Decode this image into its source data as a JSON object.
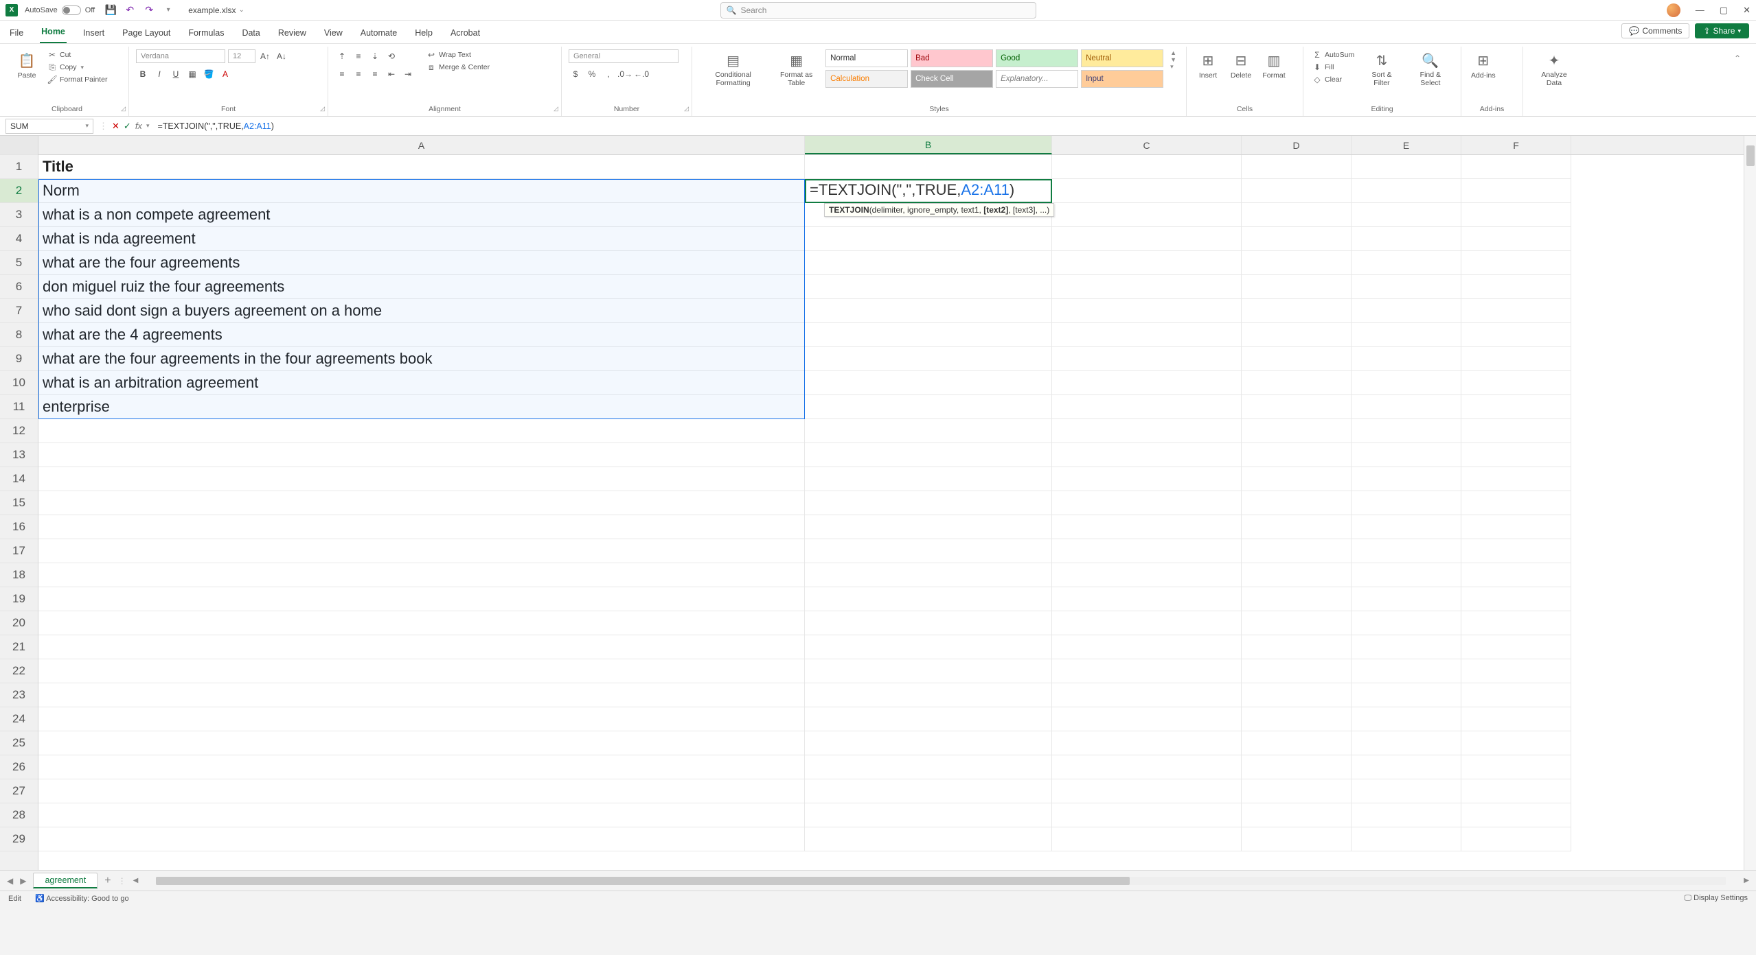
{
  "titlebar": {
    "autosave_label": "AutoSave",
    "autosave_state": "Off",
    "filename": "example.xlsx"
  },
  "search": {
    "placeholder": "Search"
  },
  "menu": {
    "tabs": [
      "File",
      "Home",
      "Insert",
      "Page Layout",
      "Formulas",
      "Data",
      "Review",
      "View",
      "Automate",
      "Help",
      "Acrobat"
    ],
    "active": "Home",
    "comments": "Comments",
    "share": "Share"
  },
  "ribbon": {
    "clipboard": {
      "label": "Clipboard",
      "paste": "Paste",
      "cut": "Cut",
      "copy": "Copy",
      "fmt": "Format Painter"
    },
    "font": {
      "label": "Font",
      "name": "Verdana",
      "size": "12"
    },
    "alignment": {
      "label": "Alignment",
      "wrap": "Wrap Text",
      "merge": "Merge & Center"
    },
    "number": {
      "label": "Number",
      "format": "General"
    },
    "styles": {
      "label": "Styles",
      "cond": "Conditional Formatting",
      "fat": "Format as Table",
      "items": [
        "Normal",
        "Bad",
        "Good",
        "Neutral",
        "Calculation",
        "Check Cell",
        "Explanatory...",
        "Input"
      ]
    },
    "cells": {
      "label": "Cells",
      "insert": "Insert",
      "delete": "Delete",
      "format": "Format"
    },
    "editing": {
      "label": "Editing",
      "autosum": "AutoSum",
      "fill": "Fill",
      "clear": "Clear",
      "sort": "Sort & Filter",
      "find": "Find & Select"
    },
    "addins": {
      "label": "Add-ins",
      "btn": "Add-ins"
    },
    "analyze": {
      "btn": "Analyze Data"
    }
  },
  "formula_bar": {
    "name": "SUM",
    "formula_prefix": "=TEXTJOIN(\",\",TRUE,",
    "formula_range": "A2:A11",
    "formula_suffix": ")"
  },
  "columns": [
    "A",
    "B",
    "C",
    "D",
    "E",
    "F"
  ],
  "row_numbers": [
    1,
    2,
    3,
    4,
    5,
    6,
    7,
    8,
    9,
    10,
    11,
    12,
    13,
    14,
    15,
    16,
    17,
    18,
    19,
    20,
    21,
    22,
    23,
    24,
    25,
    26,
    27,
    28,
    29
  ],
  "cells": {
    "A1": "Title",
    "A2": "Norm",
    "A3": "what is a non compete agreement",
    "A4": "what is nda agreement",
    "A5": "what are the four agreements",
    "A6": "don miguel ruiz the four agreements",
    "A7": "who said dont sign a buyers agreement on a home",
    "A8": "what are the 4 agreements",
    "A9": "what are the four agreements in the four agreements book",
    "A10": "what is an arbitration agreement",
    "A11": "enterprise"
  },
  "b2_formula": {
    "prefix": "=TEXTJOIN(\",\",TRUE,",
    "range": "A2:A11",
    "suffix": ")"
  },
  "tooltip": {
    "func": "TEXTJOIN",
    "sig": "(delimiter, ignore_empty, text1, ",
    "active": "[text2]",
    "rest": ", [text3], ...)"
  },
  "sheet": {
    "name": "agreement"
  },
  "status": {
    "mode": "Edit",
    "access": "Accessibility: Good to go",
    "display": "Display Settings"
  }
}
